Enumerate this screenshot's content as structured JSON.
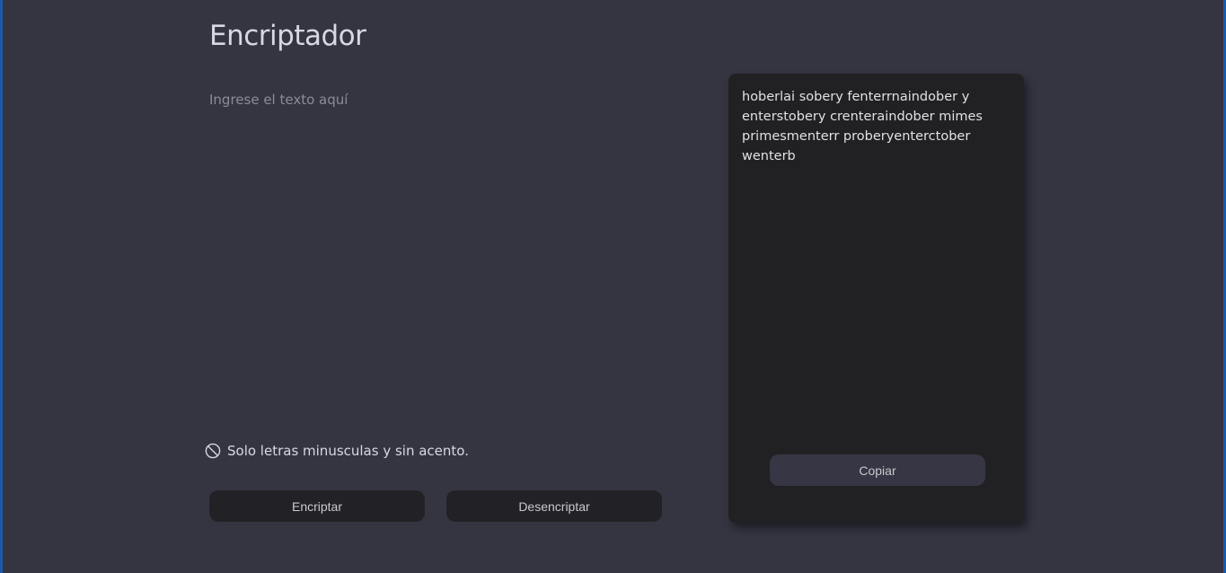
{
  "app": {
    "title": "Encriptador"
  },
  "input": {
    "placeholder": "Ingrese el texto aquí",
    "value": ""
  },
  "hint": {
    "icon": "prohibited-icon",
    "text": "Solo letras minusculas y sin acento."
  },
  "actions": {
    "encrypt_label": "Encriptar",
    "decrypt_label": "Desencriptar"
  },
  "output": {
    "text": "hoberlai sobery fenterrnaindober y enterstobery crenteraindober mimes primesmenterr proberyenterctober wenterb",
    "copy_label": "Copiar"
  },
  "colors": {
    "background": "#353542",
    "panel": "#212123",
    "button": "#222226",
    "copy_button": "#363644",
    "window_border": "#1b5aa8"
  }
}
